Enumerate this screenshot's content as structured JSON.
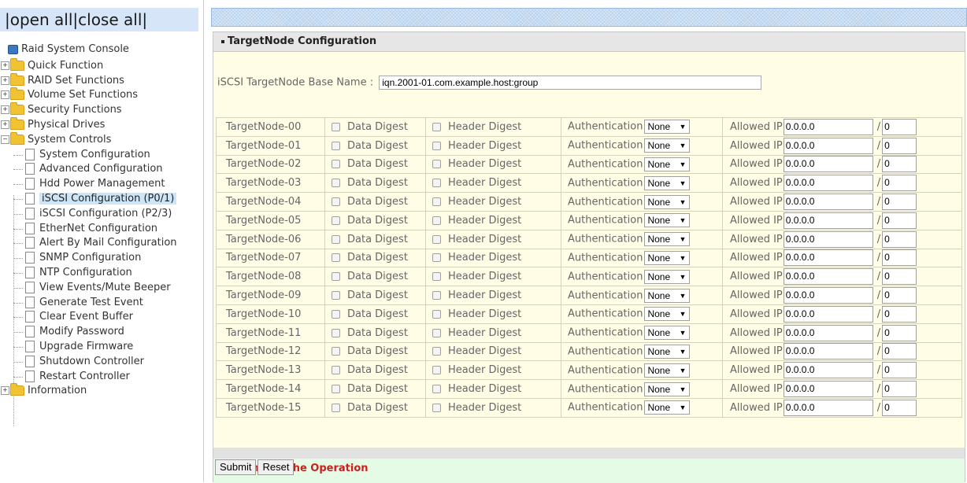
{
  "sidebar": {
    "open_all": "open all",
    "close_all": "close all",
    "root": "Raid System Console",
    "folders": [
      {
        "label": "Quick Function",
        "expanded": false
      },
      {
        "label": "RAID Set Functions",
        "expanded": false
      },
      {
        "label": "Volume Set Functions",
        "expanded": false
      },
      {
        "label": "Security Functions",
        "expanded": false
      },
      {
        "label": "Physical Drives",
        "expanded": false
      },
      {
        "label": "System Controls",
        "expanded": true
      },
      {
        "label": "Information",
        "expanded": false
      }
    ],
    "system_controls_items": [
      "System Configuration",
      "Advanced Configuration",
      "Hdd Power Management",
      "iSCSI Configuration (P0/1)",
      "iSCSI Configuration (P2/3)",
      "EtherNet Configuration",
      "Alert By Mail Configuration",
      "SNMP Configuration",
      "NTP Configuration",
      "View Events/Mute Beeper",
      "Generate Test Event",
      "Clear Event Buffer",
      "Modify Password",
      "Upgrade Firmware",
      "Shutdown Controller",
      "Restart Controller"
    ],
    "selected_item": "iSCSI Configuration (P0/1)"
  },
  "panel": {
    "title": "TargetNode Configuration",
    "base_name_label": "iSCSI TargetNode Base Name :",
    "base_name_value": "iqn.2001-01.com.example.host:group",
    "data_digest_label": "Data Digest",
    "header_digest_label": "Header Digest",
    "auth_label": "Authentication",
    "allowed_ip_label": "Allowed IP",
    "slash": "/",
    "nodes": [
      {
        "name": "TargetNode-00",
        "auth": "None",
        "ip": "0.0.0.0",
        "mask": "0"
      },
      {
        "name": "TargetNode-01",
        "auth": "None",
        "ip": "0.0.0.0",
        "mask": "0"
      },
      {
        "name": "TargetNode-02",
        "auth": "None",
        "ip": "0.0.0.0",
        "mask": "0"
      },
      {
        "name": "TargetNode-03",
        "auth": "None",
        "ip": "0.0.0.0",
        "mask": "0"
      },
      {
        "name": "TargetNode-04",
        "auth": "None",
        "ip": "0.0.0.0",
        "mask": "0"
      },
      {
        "name": "TargetNode-05",
        "auth": "None",
        "ip": "0.0.0.0",
        "mask": "0"
      },
      {
        "name": "TargetNode-06",
        "auth": "None",
        "ip": "0.0.0.0",
        "mask": "0"
      },
      {
        "name": "TargetNode-07",
        "auth": "None",
        "ip": "0.0.0.0",
        "mask": "0"
      },
      {
        "name": "TargetNode-08",
        "auth": "None",
        "ip": "0.0.0.0",
        "mask": "0"
      },
      {
        "name": "TargetNode-09",
        "auth": "None",
        "ip": "0.0.0.0",
        "mask": "0"
      },
      {
        "name": "TargetNode-10",
        "auth": "None",
        "ip": "0.0.0.0",
        "mask": "0"
      },
      {
        "name": "TargetNode-11",
        "auth": "None",
        "ip": "0.0.0.0",
        "mask": "0"
      },
      {
        "name": "TargetNode-12",
        "auth": "None",
        "ip": "0.0.0.0",
        "mask": "0"
      },
      {
        "name": "TargetNode-13",
        "auth": "None",
        "ip": "0.0.0.0",
        "mask": "0"
      },
      {
        "name": "TargetNode-14",
        "auth": "None",
        "ip": "0.0.0.0",
        "mask": "0"
      },
      {
        "name": "TargetNode-15",
        "auth": "None",
        "ip": "0.0.0.0",
        "mask": "0"
      }
    ],
    "confirm_label": "Confirm The Operation",
    "submit_label": "Submit",
    "reset_label": "Reset"
  },
  "colors": {
    "panel_bg": "#fffde5",
    "confirm_bg": "#e6fbe6",
    "confirm_text": "#cc1f1f",
    "open_close_bg": "#d6e6f8",
    "selected_item_bg": "#cde6f7"
  }
}
